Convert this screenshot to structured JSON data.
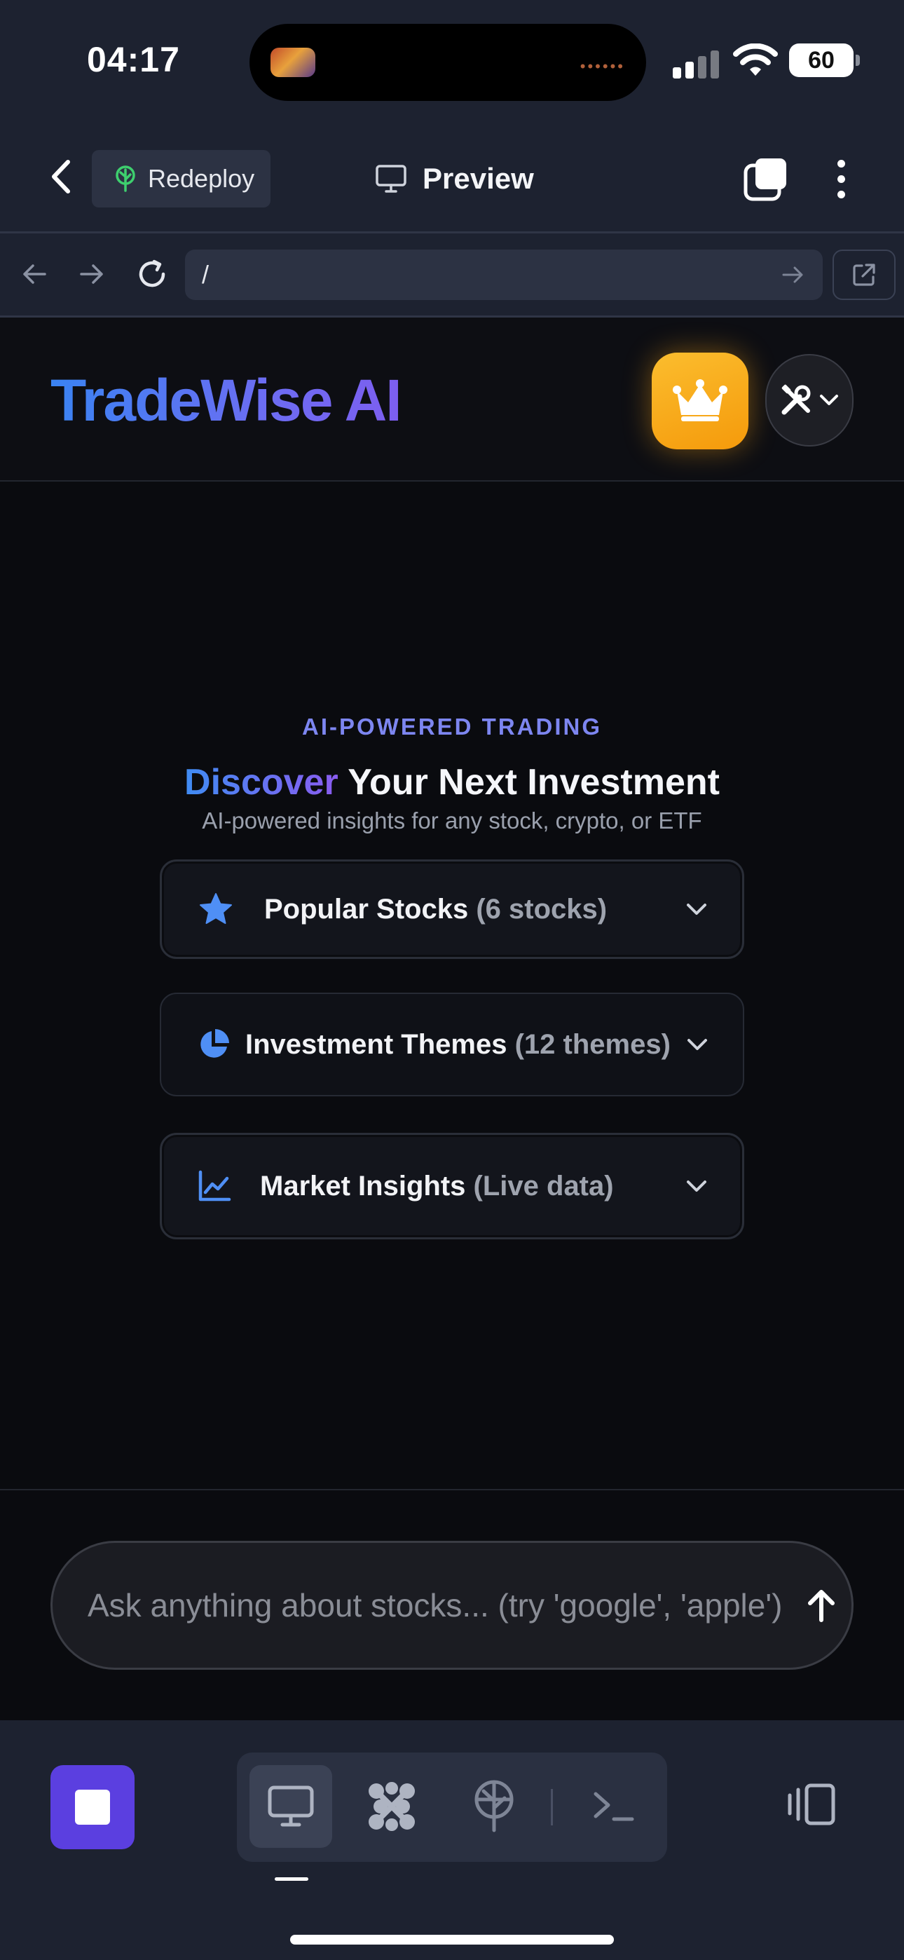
{
  "status_bar": {
    "time": "04:17",
    "battery": "60"
  },
  "top_bar": {
    "back_icon": "chevron-left-icon",
    "redeploy_label": "Redeploy",
    "redeploy_icon": "deploy-tree-icon",
    "preview_label": "Preview",
    "preview_icon": "monitor-icon",
    "tabs_icon": "tabs-icon",
    "more_icon": "more-vertical-icon"
  },
  "browser_bar": {
    "url": "/",
    "back_icon": "arrow-left-icon",
    "forward_icon": "arrow-right-icon",
    "reload_icon": "reload-icon",
    "open_external_icon": "external-link-icon"
  },
  "app": {
    "brand": "TradeWise AI",
    "premium_icon": "crown-icon",
    "tools_icon": "tools-icon",
    "eyebrow": "AI-POWERED TRADING",
    "headline_accent": "Discover",
    "headline_rest": " Your Next Investment",
    "subhead": "AI-powered insights for any stock, crypto, or ETF",
    "sections": [
      {
        "title": "Popular Stocks",
        "count": "(6 stocks)",
        "icon": "star-icon"
      },
      {
        "title": "Investment Themes",
        "count": "(12 themes)",
        "icon": "pie-chart-icon"
      },
      {
        "title": "Market Insights",
        "count": "(Live data)",
        "icon": "line-chart-icon"
      }
    ],
    "chat_placeholder": "Ask anything about stocks... (try 'google', 'apple')",
    "send_icon": "arrow-up-icon"
  },
  "bottom_bar": {
    "stop_icon": "stop-icon",
    "modes": [
      "preview-monitor-icon",
      "agent-icon",
      "deploy-icon",
      "shell-icon"
    ],
    "devices_icon": "devices-icon"
  },
  "colors": {
    "accent_blue": "#3a83f2",
    "accent_purple": "#7d5ef0",
    "premium_orange": "#f59a0b",
    "stop_purple": "#5b3fe0",
    "chrome_bg": "#1d2230",
    "app_bg": "#0a0b0f"
  }
}
